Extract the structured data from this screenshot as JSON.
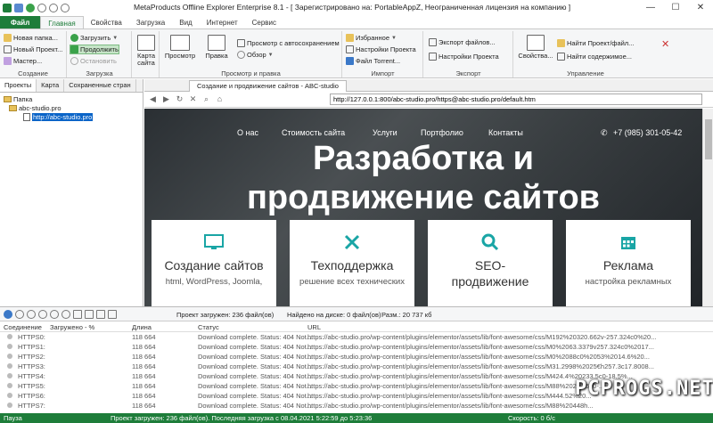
{
  "window": {
    "title": "MetaProducts Offline Explorer Enterprise 8.1 - [ Зарегистрировано на: PortableAppZ, Неограниченная лицензия на компанию ]",
    "min": "—",
    "max": "☐",
    "close": "✕"
  },
  "ribbon_tabs": [
    "Файл",
    "Главная",
    "Свойства",
    "Загрузка",
    "Вид",
    "Интернет",
    "Сервис"
  ],
  "ribbon": {
    "create": {
      "label": "Создание",
      "new_folder": "Новая папка...",
      "new_project": "Новый Проект...",
      "wizard": "Мастер..."
    },
    "download": {
      "label": "Загрузка",
      "load": "Загрузить",
      "continue": "Продолжить",
      "stop": "Остановить"
    },
    "sitemap": {
      "label": "Карта сайта"
    },
    "view": {
      "label": "Просмотр и правка",
      "preview": "Просмотр",
      "edit": "Правка",
      "autosave_view": "Просмотр с автосохранением",
      "browse": "Обзор"
    },
    "import": {
      "label": "Импорт",
      "favorites": "Избранное",
      "project_settings": "Настройки Проекта",
      "torrent_file": "Файл Torrent..."
    },
    "export": {
      "label": "Экспорт",
      "export_files": "Экспорт файлов...",
      "project_settings": "Настройки Проекта"
    },
    "manage": {
      "label": "Управление",
      "properties": "Свойства...",
      "find_project": "Найти Проект/файл...",
      "find_content": "Найти содержимое..."
    }
  },
  "left_panel": {
    "tabs": [
      "Проекты",
      "Карта",
      "Сохраненные стран"
    ],
    "tree": {
      "root": "Папка",
      "project": "abc-studio.pro",
      "url": "http://abc-studio.pro"
    }
  },
  "browser": {
    "tab_title": "Создание и продвижение сайтов - ABC-studio",
    "address": "http://127.0.0.1:800/abc-studio.pro/https@abc-studio.pro/default.htm",
    "site": {
      "nav": [
        "О нас",
        "Стоимость сайта",
        "Услуги",
        "Портфолио",
        "Контакты"
      ],
      "phone": "+7 (985) 301-05-42",
      "hero_line1": "Разработка и",
      "hero_line2": "продвижение сайтов",
      "cards": [
        {
          "icon": "monitor-icon",
          "title": "Создание сайтов",
          "subtitle": "html, WordPress, Joomla,"
        },
        {
          "icon": "tools-icon",
          "title": "Техподдержка",
          "subtitle": "решение всех технических"
        },
        {
          "icon": "search-icon",
          "title": "SEO-",
          "title2": "продвижение",
          "subtitle": ""
        },
        {
          "icon": "calendar-icon",
          "title": "Реклама",
          "subtitle": "настройка рекламных"
        }
      ]
    }
  },
  "downloads": {
    "project_loaded": "Проект загружен: 236 файл(ов)",
    "found_on_disk": "Найдено на диске: 0 файл(ов)",
    "size": "Разм.: 20 737 кб",
    "columns": [
      "Соединение",
      "Загружено - %",
      "Длина",
      "Статус",
      "URL"
    ],
    "rows": [
      {
        "conn": "HTTPS0:",
        "len": "118 664",
        "status": "Download complete. Status: 404 Not...",
        "url": "https://abc-studio.pro/wp-content/plugins/elementor/assets/lib/font-awesome/css/M192%20320.662v-257.324c0%20..."
      },
      {
        "conn": "HTTPS1:",
        "len": "118 664",
        "status": "Download complete. Status: 404 Not...",
        "url": "https://abc-studio.pro/wp-content/plugins/elementor/assets/lib/font-awesome/css/M0%2063.3379v257.324c0%2017..."
      },
      {
        "conn": "HTTPS2:",
        "len": "118 664",
        "status": "Download complete. Status: 404 Not...",
        "url": "https://abc-studio.pro/wp-content/plugins/elementor/assets/lib/font-awesome/css/M0%2088c0%2053%2014.6%20..."
      },
      {
        "conn": "HTTPS3:",
        "len": "118 664",
        "status": "Download complete. Status: 404 Not...",
        "url": "https://abc-studio.pro/wp-content/plugins/elementor/assets/lib/font-awesome/css/M31.2998%2025€h257.3c17.8008..."
      },
      {
        "conn": "HTTPS4:",
        "len": "118 664",
        "status": "Download complete. Status: 404 Not...",
        "url": "https://abc-studio.pro/wp-content/plugins/elementor/assets/lib/font-awesome/css/M424.4%20233.5c0-18.5%..."
      },
      {
        "conn": "HTTPS5:",
        "len": "118 664",
        "status": "Download complete. Status: 404 Not...",
        "url": "https://abc-studio.pro/wp-content/plugins/elementor/assets/lib/font-awesome/css/M88%20223.5c0-..."
      },
      {
        "conn": "HTTPS6:",
        "len": "118 664",
        "status": "Download complete. Status: 404 Not...",
        "url": "https://abc-studio.pro/wp-content/plugins/elementor/assets/lib/font-awesome/css/M444.52%20..."
      },
      {
        "conn": "HTTPS7:",
        "len": "118 664",
        "status": "Download complete. Status: 404 Not...",
        "url": "https://abc-studio.pro/wp-content/plugins/elementor/assets/lib/font-awesome/css/M88%20448h..."
      }
    ]
  },
  "statusbar": {
    "state": "Пауза",
    "project_info": "Проект загружен: 236 файл(ов). Последняя загрузка с 08.04.2021 5:22:59 до 5:23:36",
    "speed": "Скорость: 0 б/с"
  },
  "watermark": "PCPROGS.NET",
  "colors": {
    "accent": "#1e7d3a",
    "teal": "#19a5a5"
  }
}
